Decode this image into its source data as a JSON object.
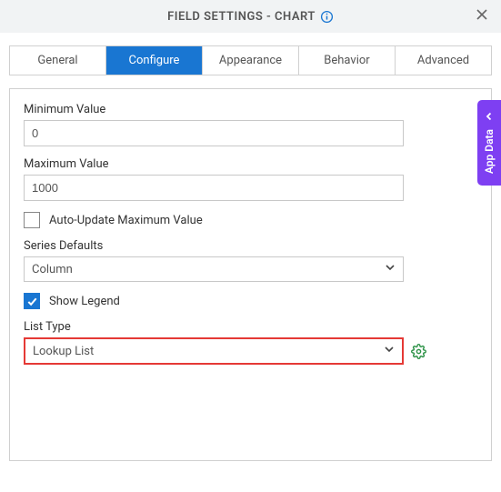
{
  "header": {
    "title": "FIELD SETTINGS - CHART"
  },
  "tabs": {
    "general": "General",
    "configure": "Configure",
    "appearance": "Appearance",
    "behavior": "Behavior",
    "advanced": "Advanced"
  },
  "form": {
    "min_label": "Minimum Value",
    "min_value": "0",
    "max_label": "Maximum Value",
    "max_value": "1000",
    "auto_update_label": "Auto-Update Maximum Value",
    "series_defaults_label": "Series Defaults",
    "series_defaults_value": "Column",
    "show_legend_label": "Show Legend",
    "list_type_label": "List Type",
    "list_type_value": "Lookup List"
  },
  "sidetab": {
    "label": "App Data"
  }
}
